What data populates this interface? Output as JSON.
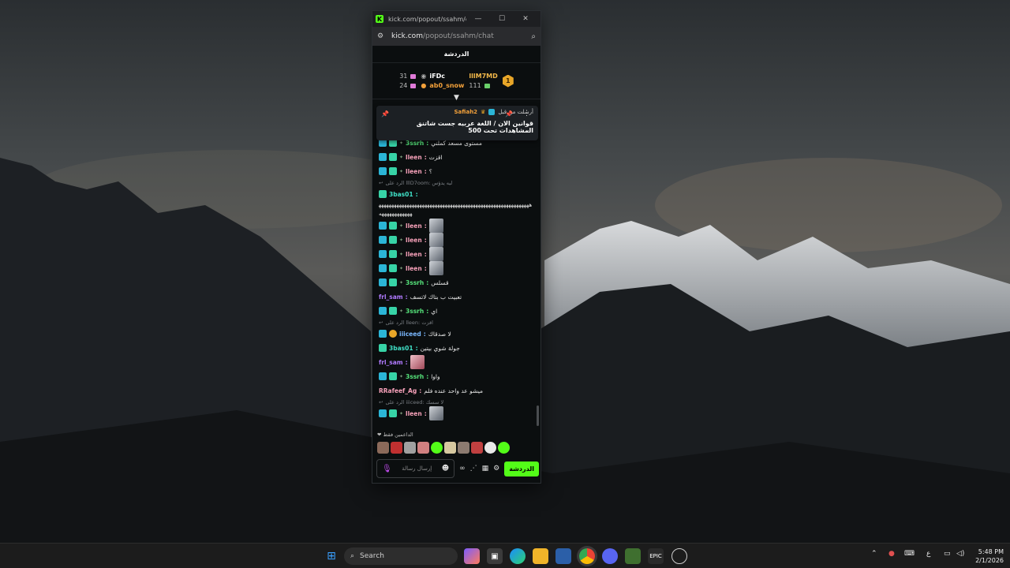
{
  "window": {
    "title": "kick.com/popout/ssahm/ch...",
    "url_host": "kick.com",
    "url_path": "/popout/ssahm/chat"
  },
  "chat": {
    "header": "الدردشة",
    "leaderboard": {
      "top_rank": "1",
      "first": {
        "name": "lllM7MD",
        "count": "111"
      },
      "second": {
        "name": "iFDc",
        "count": "31"
      },
      "third": {
        "name": "ab0_snow",
        "count": "24"
      }
    },
    "pinned": {
      "sent_by_label": "أرسلت من قبل",
      "user": "Safiah2",
      "message": "قوانين الان / اللغة عربيه جست شاتنق المشاهدات تحت 500"
    },
    "messages": [
      {
        "user": "3ssrh",
        "text": "مستوى مسعد كملني"
      },
      {
        "user": "lleen",
        "text": "اقزت"
      },
      {
        "user": "lleen",
        "text": "؟"
      },
      {
        "reply": "الرد على lllD7oom: ليه يدؤس"
      },
      {
        "user": "3bas01",
        "text": ""
      },
      {
        "long": "ههههههههههههههههههههههههههههههههههههههههههههههههههههههههههههههههههههههههه"
      },
      {
        "user": "lleen",
        "text": ""
      },
      {
        "user": "lleen",
        "text": ""
      },
      {
        "user": "lleen",
        "text": ""
      },
      {
        "user": "lleen",
        "text": ""
      },
      {
        "user": "3ssrh",
        "text": "قسلس"
      },
      {
        "user": "frl_sam",
        "text": "تعبيت ب بتاك لاتسف"
      },
      {
        "user": "3ssrh",
        "text": "اي"
      },
      {
        "reply": "الرد على lleen: اقزت"
      },
      {
        "user": "iiiceed",
        "text": "لا صدقاك"
      },
      {
        "user": "3bas01",
        "text": "جولة شوي بيتين"
      },
      {
        "user": "frl_sam",
        "text": ""
      },
      {
        "user": "3ssrh",
        "text": "واوا"
      },
      {
        "user": "RRafeef_Ag",
        "text": "ميشو عد واحد عنده فلم"
      },
      {
        "reply": "الرد على iiiceed: لا سسك"
      },
      {
        "user": "lleen",
        "text": ""
      }
    ],
    "supporters_label": "الداعمين فقط",
    "input_placeholder": "إرسال رسالة",
    "chat_button": "الدردشة"
  },
  "taskbar": {
    "search_label": "Search",
    "lang": "ع",
    "time": "5:48 PM",
    "date": "2/1/2026"
  }
}
